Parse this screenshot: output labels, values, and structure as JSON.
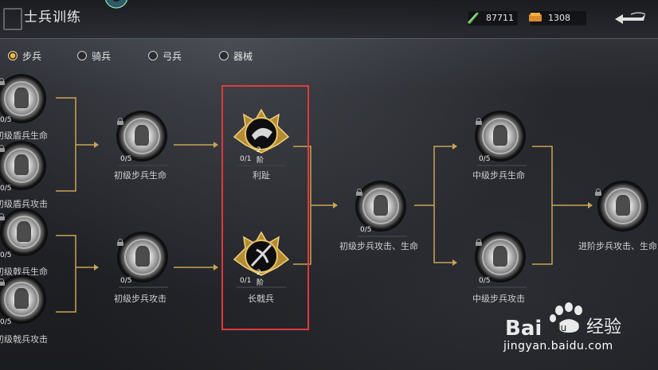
{
  "header": {
    "title": "士兵训练",
    "resources": [
      {
        "icon": "jade-feather-icon",
        "value": "87711"
      },
      {
        "icon": "gold-ingot-icon",
        "value": "1308"
      }
    ]
  },
  "tabs": [
    {
      "label": "步兵",
      "selected": true
    },
    {
      "label": "骑兵",
      "selected": false
    },
    {
      "label": "弓兵",
      "selected": false
    },
    {
      "label": "器械",
      "selected": false
    }
  ],
  "nodes": {
    "shield_hp": {
      "label": "初级盾兵生命",
      "count": "0/5"
    },
    "shield_atk": {
      "label": "初级盾兵攻击",
      "count": "0/5"
    },
    "halberd_hp": {
      "label": "初级戟兵生命",
      "count": "0/5"
    },
    "halberd_atk": {
      "label": "初级戟兵攻击",
      "count": "0/5"
    },
    "inf_hp": {
      "label": "初级步兵生命",
      "count": "0/5"
    },
    "inf_atk": {
      "label": "初级步兵攻击",
      "count": "0/5"
    },
    "lizhi": {
      "label": "利趾",
      "count": "0/1",
      "rank": "2阶"
    },
    "changjibing": {
      "label": "长戟兵",
      "count": "0/1",
      "rank": "2阶"
    },
    "inf_atk_hp": {
      "label": "初级步兵攻击、生命",
      "count": "0/5"
    },
    "mid_hp": {
      "label": "中级步兵生命",
      "count": "0/5"
    },
    "mid_atk": {
      "label": "中级步兵攻击",
      "count": "0/5"
    },
    "adv_atk_hp": {
      "label": "进阶步兵攻击、生命"
    }
  },
  "watermark": {
    "text": "jingyan.baidu.com",
    "brand": "Bai",
    "brand2": "du",
    "brand3": "经验"
  },
  "colors": {
    "gold": "#c9a455",
    "highlight": "#e03a3a",
    "connector": "#c9a455"
  }
}
